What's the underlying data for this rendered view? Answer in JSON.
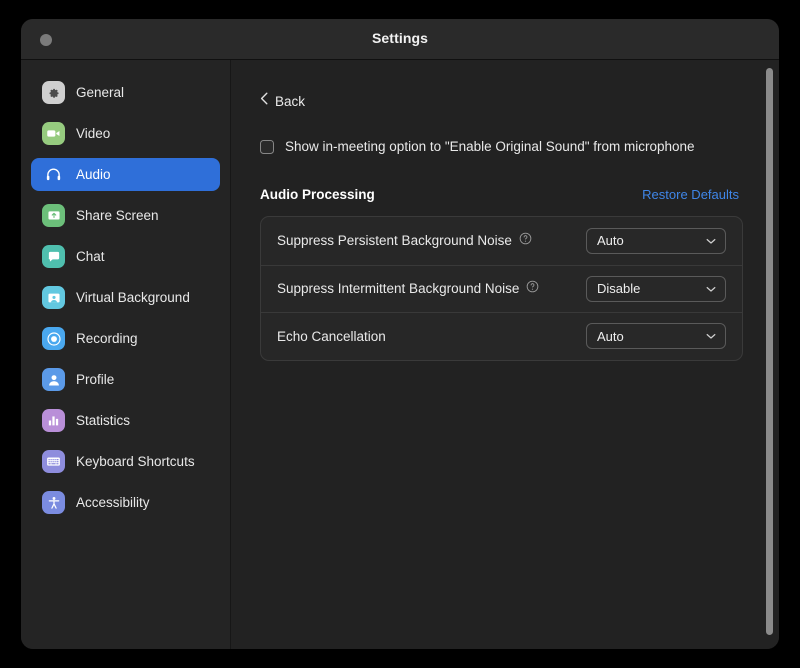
{
  "window": {
    "title": "Settings",
    "close_button": "close-button"
  },
  "sidebar": {
    "items": [
      {
        "id": "general",
        "label": "General",
        "icon": "gear-icon",
        "icon_bg": "#cfcfcf",
        "selected": false
      },
      {
        "id": "video",
        "label": "Video",
        "icon": "camera-icon",
        "icon_bg": "#96cb7f",
        "selected": false
      },
      {
        "id": "audio",
        "label": "Audio",
        "icon": "headphones-icon",
        "icon_bg": "#2f6fd9",
        "selected": true
      },
      {
        "id": "share-screen",
        "label": "Share Screen",
        "icon": "share-screen-icon",
        "icon_bg": "#6cbf7a",
        "selected": false
      },
      {
        "id": "chat",
        "label": "Chat",
        "icon": "chat-bubble-icon",
        "icon_bg": "#4fbfae",
        "selected": false
      },
      {
        "id": "virtual-background",
        "label": "Virtual Background",
        "icon": "virtual-background-icon",
        "icon_bg": "#62c8e0",
        "selected": false
      },
      {
        "id": "recording",
        "label": "Recording",
        "icon": "record-icon",
        "icon_bg": "#4aa8ef",
        "selected": false
      },
      {
        "id": "profile",
        "label": "Profile",
        "icon": "person-icon",
        "icon_bg": "#5b9ae8",
        "selected": false
      },
      {
        "id": "statistics",
        "label": "Statistics",
        "icon": "bar-chart-icon",
        "icon_bg": "#b98fd8",
        "selected": false
      },
      {
        "id": "keyboard-shortcuts",
        "label": "Keyboard Shortcuts",
        "icon": "keyboard-icon",
        "icon_bg": "#8e8ddd",
        "selected": false
      },
      {
        "id": "accessibility",
        "label": "Accessibility",
        "icon": "accessibility-icon",
        "icon_bg": "#7b8ce0",
        "selected": false
      }
    ]
  },
  "main": {
    "back": {
      "label": "Back",
      "icon": "chevron-left-icon"
    },
    "original_sound": {
      "label": "Show in-meeting option to \"Enable Original Sound\" from microphone",
      "checked": false
    },
    "section": {
      "title": "Audio Processing",
      "restore_label": "Restore Defaults"
    },
    "rows": [
      {
        "id": "suppress-persistent-background-noise",
        "label": "Suppress Persistent Background Noise",
        "has_help": true,
        "value": "Auto"
      },
      {
        "id": "suppress-intermittent-background-noise",
        "label": "Suppress Intermittent Background Noise",
        "has_help": true,
        "value": "Disable"
      },
      {
        "id": "echo-cancellation",
        "label": "Echo Cancellation",
        "has_help": false,
        "value": "Auto"
      }
    ]
  },
  "colors": {
    "accent": "#2f6fd9",
    "link": "#3f86e8",
    "window_bg": "#222222",
    "sidebar_bg": "#242424",
    "titlebar_bg": "#2a2a2a"
  }
}
